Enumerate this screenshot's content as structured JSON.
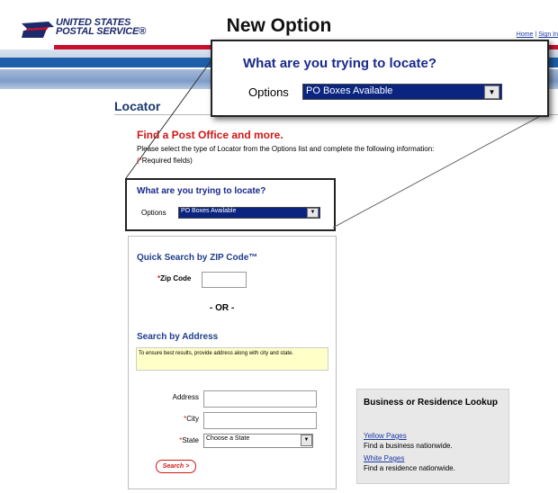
{
  "header": {
    "logo_text_line1": "UNITED STATES",
    "logo_text_line2": "POSTAL SERVICE®",
    "page_title": "New Option",
    "links": [
      "Home",
      "|",
      "Sign In"
    ]
  },
  "callout": {
    "question": "What are you trying to locate?",
    "options_label": "Options",
    "selected_option": "PO Boxes Available"
  },
  "locator": {
    "title": "Locator",
    "find_title": "Find a Post Office and more.",
    "description": "Please select the type of Locator from the Options list and complete the following information:",
    "required_star": "(*",
    "required_text": "Required fields)",
    "question": "What are you trying to locate?",
    "options_label": "Options",
    "selected_option": "PO Boxes Available"
  },
  "quick_search": {
    "title": "Quick Search by ZIP Code™",
    "zip_label": "Zip Code",
    "zip_value": "",
    "or_text": "- OR -"
  },
  "address_search": {
    "title": "Search by Address",
    "tip": "To ensure best results, provide address along with city and state.",
    "address_label": "Address",
    "city_label": "City",
    "state_label": "State",
    "state_selected": "Choose a State",
    "search_button": "Search >"
  },
  "business_lookup": {
    "title": "Business or Residence Lookup",
    "yellow_pages_link": "Yellow Pages",
    "yellow_pages_desc": "Find a business nationwide.",
    "white_pages_link": "White Pages",
    "white_pages_desc": "Find a residence nationwide."
  },
  "colors": {
    "brand_blue": "#1d5faa",
    "brand_red": "#c8102e",
    "select_highlight": "#0a2480"
  }
}
